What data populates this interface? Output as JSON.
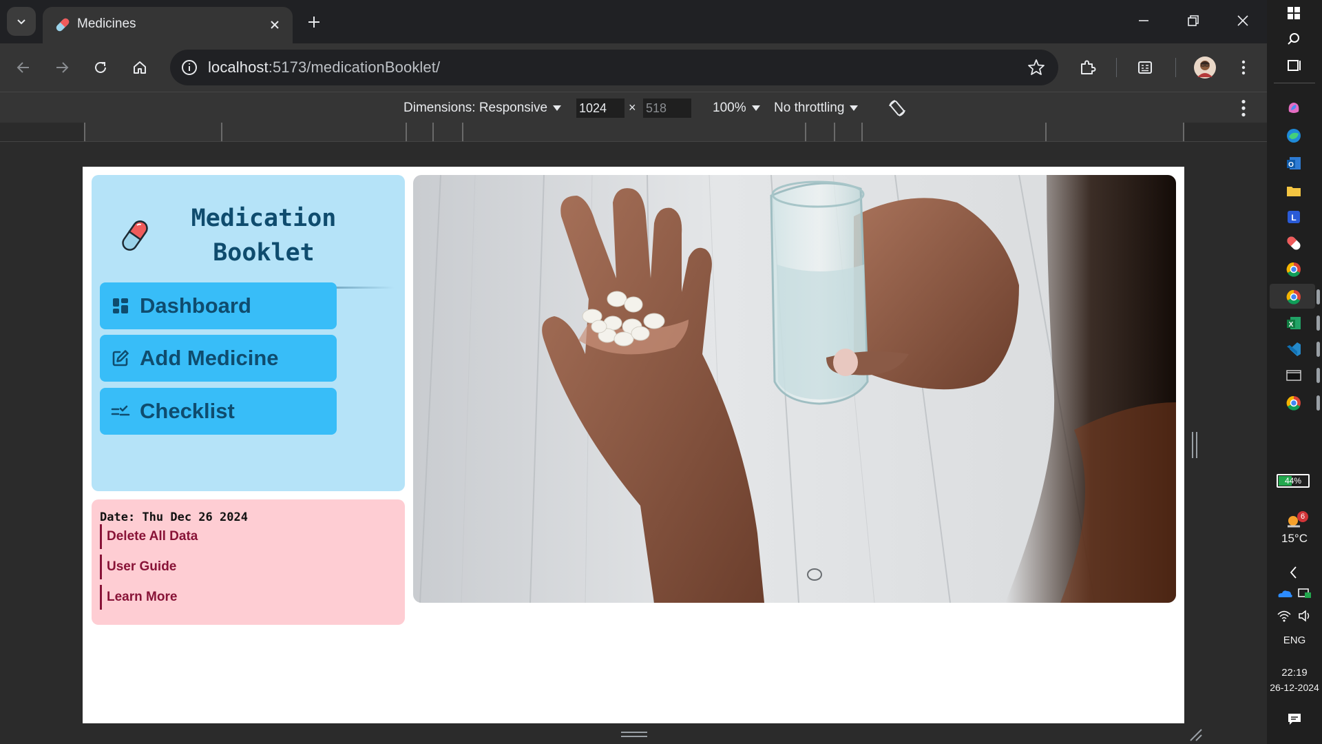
{
  "browser": {
    "tab_title": "Medicines",
    "url_host": "localhost",
    "url_rest": ":5173/medicationBooklet/"
  },
  "devtools": {
    "dimensions_label": "Dimensions: Responsive",
    "width_value": "1024",
    "height_placeholder": "518",
    "times_symbol": "×",
    "zoom": "100%",
    "throttling": "No throttling"
  },
  "app": {
    "brand": {
      "title": "Medication Booklet",
      "icon": "pill-capsule-icon"
    },
    "nav": [
      {
        "label": "Dashboard",
        "icon": "dashboard-grid-icon"
      },
      {
        "label": "Add Medicine",
        "icon": "edit-square-icon"
      },
      {
        "label": "Checklist",
        "icon": "checklist-icon"
      }
    ],
    "info": {
      "date": "Date: Thu Dec 26 2024",
      "links": [
        "Delete All Data",
        "User Guide",
        "Learn More"
      ]
    },
    "hero_image": "hand-holding-pills-and-water-glass"
  },
  "taskbar": {
    "battery": "44%",
    "weather_badge": "6",
    "temperature": "15°C",
    "language": "ENG",
    "time": "22:19",
    "date": "26-12-2024"
  },
  "colors": {
    "sidebar_bg": "#b5e3f8",
    "nav_button_bg": "#38bdf8",
    "nav_text": "#0f4c6e",
    "info_bg": "#fecdd3",
    "info_link": "#881337"
  }
}
